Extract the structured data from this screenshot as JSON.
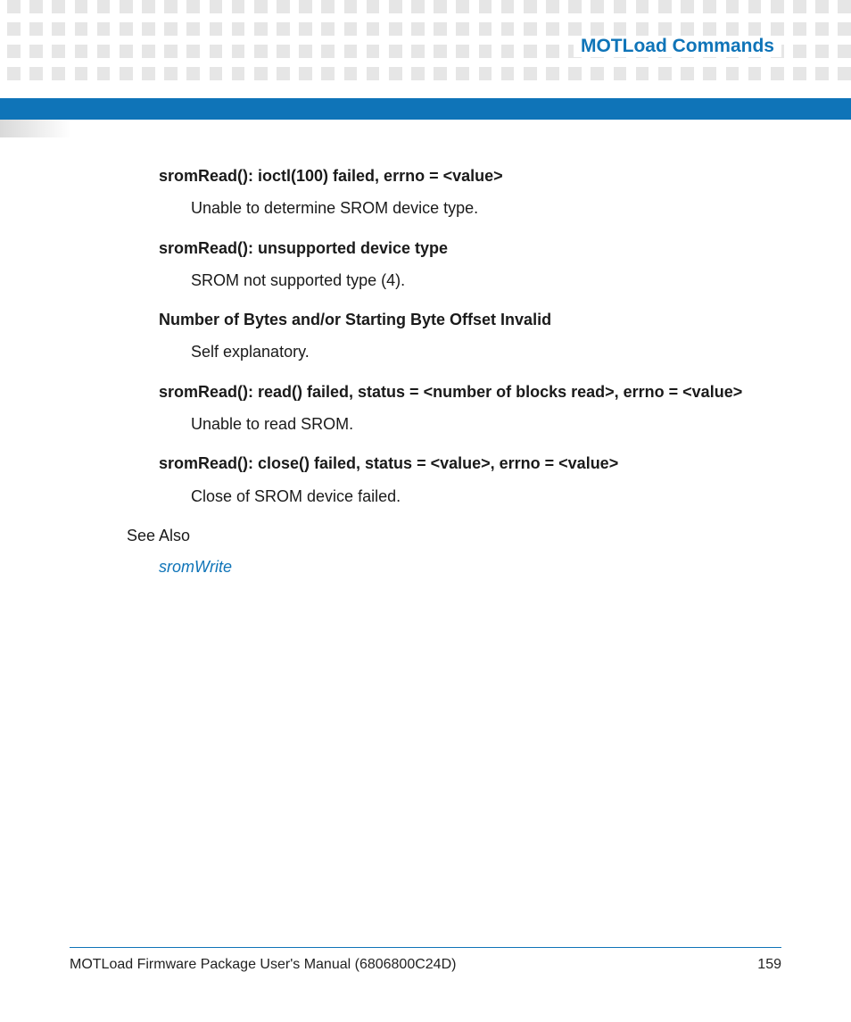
{
  "header": {
    "title": "MOTLoad Commands"
  },
  "errors": [
    {
      "heading": "sromRead(): ioctl(100) failed, errno = <value>",
      "desc": "Unable to determine SROM device type."
    },
    {
      "heading": "sromRead(): unsupported device type",
      "desc": "SROM not supported type (4)."
    },
    {
      "heading": "Number of Bytes and/or Starting Byte Offset Invalid",
      "desc": "Self explanatory."
    },
    {
      "heading": "sromRead(): read() failed, status = <number of blocks read>, errno = <value>",
      "desc": "Unable to read SROM."
    },
    {
      "heading": "sromRead(): close() failed, status = <value>, errno = <value>",
      "desc": "Close of SROM device failed."
    }
  ],
  "seeAlso": {
    "label": "See Also",
    "link": "sromWrite"
  },
  "footer": {
    "manual": "MOTLoad Firmware Package User's Manual (6806800C24D)",
    "page": "159"
  }
}
